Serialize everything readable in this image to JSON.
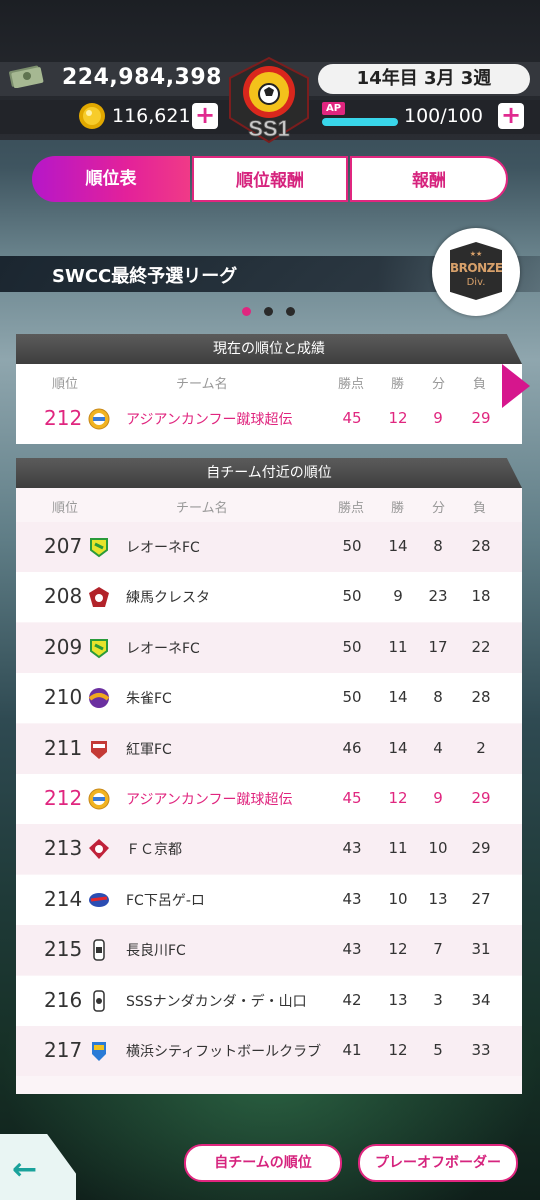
{
  "header": {
    "money": "224,984,398",
    "coins": "116,621",
    "plus": "+",
    "date": "14年目 3月 3週",
    "ap_label": "AP",
    "ap_text": "100/100",
    "ap_fraction": 1.0,
    "emblem_text": "SS1"
  },
  "tabs": [
    "順位表",
    "順位報酬",
    "報酬"
  ],
  "league": {
    "title": "SWCC最終予選リーグ",
    "division_stars": "★★",
    "division": "BRONZE",
    "division_sub": "Div."
  },
  "columns": {
    "rank": "順位",
    "team": "チーム名",
    "points": "勝点",
    "wins": "勝",
    "draws": "分",
    "losses": "負"
  },
  "current": {
    "heading": "現在の順位と成績",
    "row": {
      "rank": "212",
      "team": "アジアンカンフー蹴球超伝",
      "points": "45",
      "wins": "12",
      "draws": "9",
      "losses": "29"
    }
  },
  "nearby": {
    "heading": "自チーム付近の順位",
    "rows": [
      {
        "rank": "207",
        "team": "レオーネFC",
        "points": "50",
        "wins": "14",
        "draws": "8",
        "losses": "28"
      },
      {
        "rank": "208",
        "team": "練馬クレスタ",
        "points": "50",
        "wins": "9",
        "draws": "23",
        "losses": "18"
      },
      {
        "rank": "209",
        "team": "レオーネFC",
        "points": "50",
        "wins": "11",
        "draws": "17",
        "losses": "22"
      },
      {
        "rank": "210",
        "team": "朱雀FC",
        "points": "50",
        "wins": "14",
        "draws": "8",
        "losses": "28"
      },
      {
        "rank": "211",
        "team": "紅軍FC",
        "points": "46",
        "wins": "14",
        "draws": "4",
        "losses": "2"
      },
      {
        "rank": "212",
        "team": "アジアンカンフー蹴球超伝",
        "points": "45",
        "wins": "12",
        "draws": "9",
        "losses": "29"
      },
      {
        "rank": "213",
        "team": "ＦＣ京都",
        "points": "43",
        "wins": "11",
        "draws": "10",
        "losses": "29"
      },
      {
        "rank": "214",
        "team": "FC下呂ゲ-ロ",
        "points": "43",
        "wins": "10",
        "draws": "13",
        "losses": "27"
      },
      {
        "rank": "215",
        "team": "長良川FC",
        "points": "43",
        "wins": "12",
        "draws": "7",
        "losses": "31"
      },
      {
        "rank": "216",
        "team": "SSSナンダカンダ・デ・山口",
        "points": "42",
        "wins": "13",
        "draws": "3",
        "losses": "34"
      },
      {
        "rank": "217",
        "team": "横浜シティフットボールクラブ",
        "points": "41",
        "wins": "12",
        "draws": "5",
        "losses": "33"
      }
    ]
  },
  "buttons": {
    "own_rank": "自チームの順位",
    "playoff": "プレーオフボーダー"
  },
  "colors": {
    "accent": "#e0267f",
    "tab_active_from": "#b617c9",
    "ap_bar": "#39d6ea",
    "back": "#1aa29b"
  }
}
